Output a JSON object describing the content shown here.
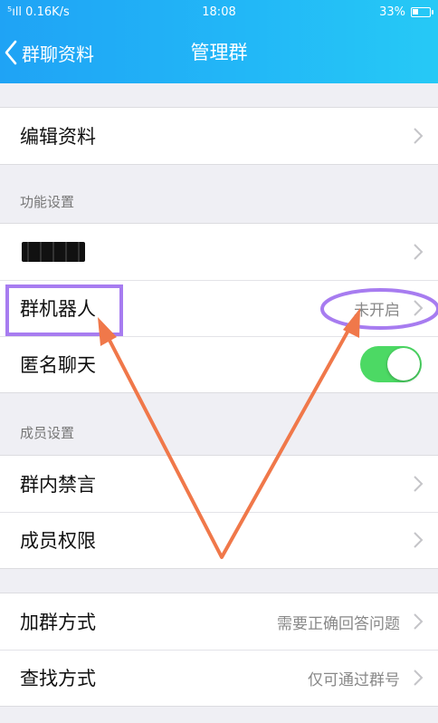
{
  "status_bar": {
    "signal": "⁵ıll 0.16K/s",
    "time": "18:08",
    "battery": "33%",
    "battery_level": 0.33
  },
  "nav": {
    "back_label": "群聊资料",
    "title": "管理群"
  },
  "groups": {
    "edit": {
      "label": "编辑资料"
    },
    "function_header": "功能设置",
    "function_rows": [
      {
        "label": ""
      },
      {
        "label": "群机器人",
        "value": "未开启"
      },
      {
        "label": "匿名聊天",
        "toggle_on": true
      }
    ],
    "member_header": "成员设置",
    "member_rows": [
      {
        "label": "群内禁言"
      },
      {
        "label": "成员权限"
      }
    ],
    "join_rows": [
      {
        "label": "加群方式",
        "value": "需要正确回答问题"
      },
      {
        "label": "查找方式",
        "value": "仅可通过群号"
      }
    ]
  },
  "colors": {
    "header_gradient_start": "#1fa3f5",
    "header_gradient_end": "#26c9f6",
    "toggle_on": "#4cd964",
    "annotation_purple": "#a77cf0",
    "annotation_orange": "#f0784a"
  }
}
